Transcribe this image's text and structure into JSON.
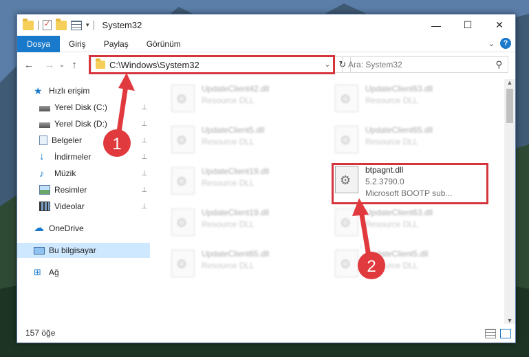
{
  "window": {
    "title": "System32"
  },
  "title_controls": {
    "minimize": "—",
    "maximize": "☐",
    "close": "✕"
  },
  "ribbon": {
    "tabs": [
      "Dosya",
      "Giriş",
      "Paylaş",
      "Görünüm"
    ],
    "expand_icon": "chevron-down-icon",
    "help_label": "?"
  },
  "nav": {
    "back": "←",
    "forward": "→",
    "recent": "⌄",
    "up": "↑"
  },
  "address": {
    "path": "C:\\Windows\\System32",
    "refresh": "↻"
  },
  "search": {
    "placeholder": "Ara: System32",
    "icon": "⚲"
  },
  "sidebar": {
    "items": [
      {
        "label": "Hızlı erişim",
        "icon": "star-icon",
        "pinned": false
      },
      {
        "label": "Yerel Disk (C:)",
        "icon": "drive-icon",
        "pinned": true
      },
      {
        "label": "Yerel Disk (D:)",
        "icon": "drive-icon",
        "pinned": true
      },
      {
        "label": "Belgeler",
        "icon": "document-icon",
        "pinned": true
      },
      {
        "label": "İndirmeler",
        "icon": "download-icon",
        "pinned": true
      },
      {
        "label": "Müzik",
        "icon": "music-icon",
        "pinned": true
      },
      {
        "label": "Resimler",
        "icon": "picture-icon",
        "pinned": true
      },
      {
        "label": "Videolar",
        "icon": "video-icon",
        "pinned": true
      },
      {
        "label": "OneDrive",
        "icon": "cloud-icon",
        "pinned": false
      },
      {
        "label": "Bu bilgisayar",
        "icon": "computer-icon",
        "pinned": false,
        "selected": true
      },
      {
        "label": "Ağ",
        "icon": "network-icon",
        "pinned": false
      }
    ],
    "pin_glyph": "📌"
  },
  "files": [
    {
      "name": "UpdateClient42.dll",
      "desc": "Resource DLL",
      "blurred": true
    },
    {
      "name": "UpdateClient63.dll",
      "desc": "Resource DLL",
      "blurred": true
    },
    {
      "name": "UpdateClient5.dll",
      "desc": "Resource DLL",
      "blurred": true
    },
    {
      "name": "UpdateClient65.dll",
      "desc": "Resource DLL",
      "blurred": true
    },
    {
      "name": "UpdateClient19.dll",
      "desc": "Resource DLL",
      "blurred": true
    },
    {
      "name": "btpagnt.dll",
      "version": "5.2.3790.0",
      "desc": "Microsoft BOOTP sub...",
      "blurred": false
    },
    {
      "name": "UpdateClient19.dll",
      "desc": "Resource DLL",
      "blurred": true
    },
    {
      "name": "UpdateClient63.dll",
      "desc": "Resource DLL",
      "blurred": true
    },
    {
      "name": "UpdateClient65.dll",
      "desc": "Resource DLL",
      "blurred": true
    },
    {
      "name": "UpdateClient5.dll",
      "desc": "Resource DLL",
      "blurred": true
    }
  ],
  "status": {
    "count": "157 öğe"
  },
  "annotations": {
    "step1": "1",
    "step2": "2",
    "color": "#e0393e"
  }
}
